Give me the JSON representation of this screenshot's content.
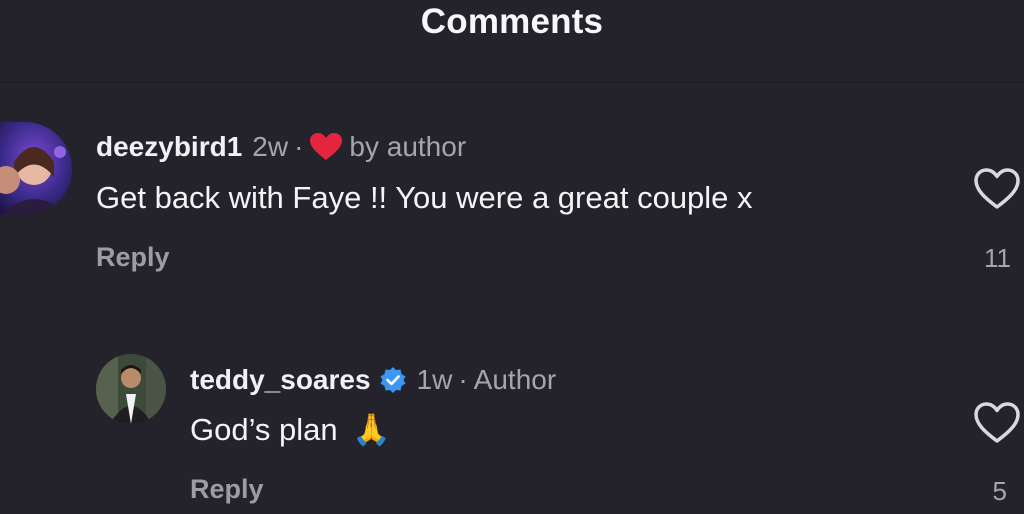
{
  "header": {
    "title": "Comments"
  },
  "comments": [
    {
      "username": "deezybird1",
      "time": "2w",
      "liked_by_author_label": "by author",
      "text": "Get back with Faye !! You were a great couple x",
      "reply_label": "Reply",
      "like_count": "11"
    },
    {
      "username": "teddy_soares",
      "time": "1w",
      "author_badge": "Author",
      "text": "God’s plan",
      "emoji": "🙏",
      "reply_label": "Reply",
      "like_count": "5"
    }
  ],
  "colors": {
    "background": "#24232b",
    "heart_red": "#e5243f",
    "verified_blue": "#3b97f3",
    "muted_text": "#a6a5ad"
  },
  "icons": {
    "liked_by_author": "red-heart-icon",
    "like": "heart-outline-icon",
    "verified": "verified-badge-icon"
  }
}
